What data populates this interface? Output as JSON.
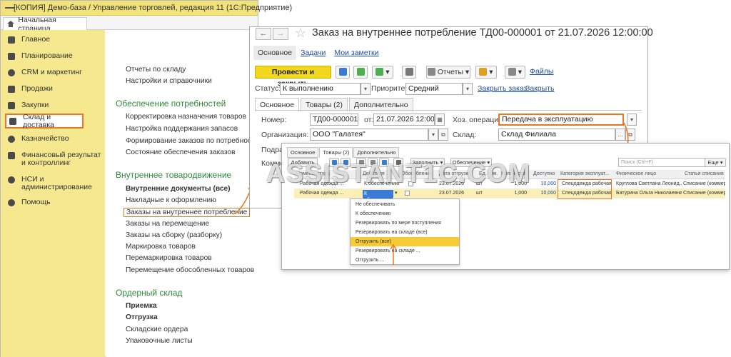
{
  "app": {
    "title": "[КОПИЯ] Демо-база / Управление торговлей, редакция 11  (1С:Предприятие)",
    "home_tab": "Начальная страница"
  },
  "sidebar": {
    "items": [
      {
        "label": "Главное",
        "icon": "list-icon"
      },
      {
        "label": "Планирование",
        "icon": "chart-icon"
      },
      {
        "label": "CRM и маркетинг",
        "icon": "pie-icon"
      },
      {
        "label": "Продажи",
        "icon": "bag-icon"
      },
      {
        "label": "Закупки",
        "icon": "cart-icon"
      },
      {
        "label": "Склад и доставка",
        "icon": "warehouse-icon"
      },
      {
        "label": "Казначейство",
        "icon": "cash-icon"
      },
      {
        "label": "Финансовый результат и контроллинг",
        "icon": "finance-icon"
      },
      {
        "label": "НСИ и администрирование",
        "icon": "gear-icon"
      },
      {
        "label": "Помощь",
        "icon": "help-icon"
      }
    ]
  },
  "content": {
    "top_links": [
      "Отчеты по складу",
      "Настройки и справочники"
    ],
    "sections": [
      {
        "heading": "Обеспечение потребностей",
        "links": [
          "Корректировка назначения товаров",
          "Настройка поддержания запасов",
          "Формирование заказов по потребностям",
          "Состояние обеспечения заказов"
        ]
      },
      {
        "heading": "Внутреннее товародвижение",
        "links": [
          "Внутренние документы (все)",
          "Накладные к оформлению",
          "Заказы на внутреннее потребление",
          "Заказы на перемещение",
          "Заказы на сборку (разборку)",
          "Маркировка товаров",
          "Перемаркировка товаров",
          "Перемещение обособленных товаров"
        ]
      },
      {
        "heading": "Ордерный склад",
        "links": [
          "Приемка",
          "Отгрузка",
          "Складские ордера",
          "Упаковочные листы"
        ]
      }
    ]
  },
  "doc": {
    "title": "Заказ на внутреннее потребление ТД00-000001 от 21.07.2026 12:00:00",
    "tabs": [
      "Основное",
      "Задачи",
      "Мои заметки"
    ],
    "post_close": "Провести и закрыть",
    "reports": "Отчеты",
    "files": "Файлы",
    "status_label": "Статус:",
    "status_value": "К выполнению",
    "priority_label": "Приоритет:",
    "priority_value": "Средний",
    "close_order": "Закрыть заказ",
    "close": "Закрыть",
    "section_tabs": [
      "Основное",
      "Товары (2)",
      "Дополнительно"
    ],
    "number_label": "Номер:",
    "number_value": "ТД00-000001",
    "from_label": "от:",
    "date_value": "21.07.2026 12:00:00",
    "op_label": "Хоз. операция:",
    "op_value": "Передача в эксплуатацию",
    "org_label": "Организация:",
    "org_value": "ООО \"Галатея\"",
    "warehouse_label": "Склад:",
    "warehouse_value": "Склад Филиала",
    "dept_label": "Подраз",
    "comment_label": "Комме"
  },
  "goods": {
    "tabs": [
      "Основное",
      "Товары (2)",
      "Дополнительно"
    ],
    "add": "Добавить",
    "fill": "Заполнить",
    "provision": "Обеспечение",
    "search_placeholder": "Поиск (Ctrl+F)",
    "more": "Еще",
    "columns": [
      "Номенклатура",
      "Действия",
      "Обособленно",
      "Дата отгрузки",
      "Ед. изм.",
      "Количество",
      "Доступно",
      "Категория эксплуат...",
      "Физическое лицо",
      "Статья списания"
    ],
    "rows": [
      {
        "item": "Рабочая одежда ...",
        "action": "К обеспечению",
        "date": "23.07.2026",
        "unit": "шт",
        "qty": "1,000",
        "avail": "10,000",
        "category": "Спецодежда рабочая",
        "person": "Круглова Светлана Леонид...",
        "article": "Списание (коммерч.)"
      },
      {
        "item": "Рабочая одежда ...",
        "action": "К обеспечению",
        "date": "23.07.2026",
        "unit": "шт",
        "qty": "1,000",
        "avail": "10,000",
        "category": "Спецодежда рабочая",
        "person": "Батурина Ольга Николаевна",
        "article": "Списание (коммерч.)"
      }
    ],
    "editor_value": "К обеспечен",
    "menu": [
      "Не обеспечивать",
      "К обеспечению",
      "Резервировать по мере поступления",
      "Резервировать на складе (все)",
      "Отгрузить (все)",
      "Резервировать на складе ...",
      "Отгрузить ..."
    ]
  },
  "watermark": "ASSISTANT1C.COM",
  "colors": {
    "accent": "#e87722",
    "sidebar": "#f6e88f",
    "title_bar": "#f2e27a",
    "primary_button": "#f2d71f",
    "link": "#1b4ea1",
    "heading": "#2e8b3a"
  }
}
